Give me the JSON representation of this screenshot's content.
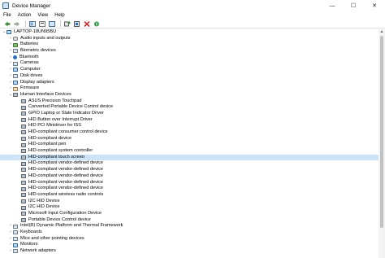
{
  "window": {
    "title": "Device Manager",
    "minimize_glyph": "—",
    "maximize_glyph": "☐",
    "close_glyph": "✕"
  },
  "menu": [
    "File",
    "Action",
    "View",
    "Help"
  ],
  "toolbar": {
    "buttons": [
      "back-icon",
      "forward-icon",
      "show-hide-icon",
      "help-icon",
      "properties-icon",
      "scan-icon",
      "update-driver-icon",
      "uninstall-icon",
      "enable-icon"
    ]
  },
  "tree": {
    "root": "LAPTOP-18UN95BU",
    "categories_before": [
      {
        "label": "Audio inputs and outputs",
        "icon": "audio"
      },
      {
        "label": "Batteries",
        "icon": "batt"
      },
      {
        "label": "Biometric devices",
        "icon": ""
      },
      {
        "label": "Bluetooth",
        "icon": "bt"
      },
      {
        "label": "Cameras",
        "icon": ""
      },
      {
        "label": "Computer",
        "icon": "comp"
      },
      {
        "label": "Disk drives",
        "icon": ""
      },
      {
        "label": "Display adapters",
        "icon": "comp"
      },
      {
        "label": "Firmware",
        "icon": "fw"
      }
    ],
    "expanded_category": "Human Interface Devices",
    "hid_devices": [
      "ASUS Precision Touchpad",
      "Converted Portable Device Control device",
      "GPIO Laptop or Slate Indicator Driver",
      "HID Button over Interrupt Driver",
      "HID PCI Minidriver for ISS",
      "HID-compliant consumer control device",
      "HID-compliant device",
      "HID-compliant pen",
      "HID-compliant system controller",
      "HID-compliant touch screen",
      "HID-compliant vendor-defined device",
      "HID-compliant vendor-defined device",
      "HID-compliant vendor-defined device",
      "HID-compliant vendor-defined device",
      "HID-compliant vendor-defined device",
      "HID-compliant wireless radio controls",
      "I2C HID Device",
      "I2C HID Device",
      "Microsoft Input Configuration Device",
      "Portable Device Control device"
    ],
    "selected_device": "HID-compliant touch screen",
    "categories_after": [
      {
        "label": "Intel(R) Dynamic Platform and Thermal Framework",
        "icon": ""
      },
      {
        "label": "Keyboards",
        "icon": ""
      },
      {
        "label": "Mice and other pointing devices",
        "icon": ""
      },
      {
        "label": "Monitors",
        "icon": "comp"
      },
      {
        "label": "Network adapters",
        "icon": ""
      }
    ]
  },
  "glyphs": {
    "collapsed": "›",
    "expanded": "⌄",
    "scroll_up": "▲"
  }
}
